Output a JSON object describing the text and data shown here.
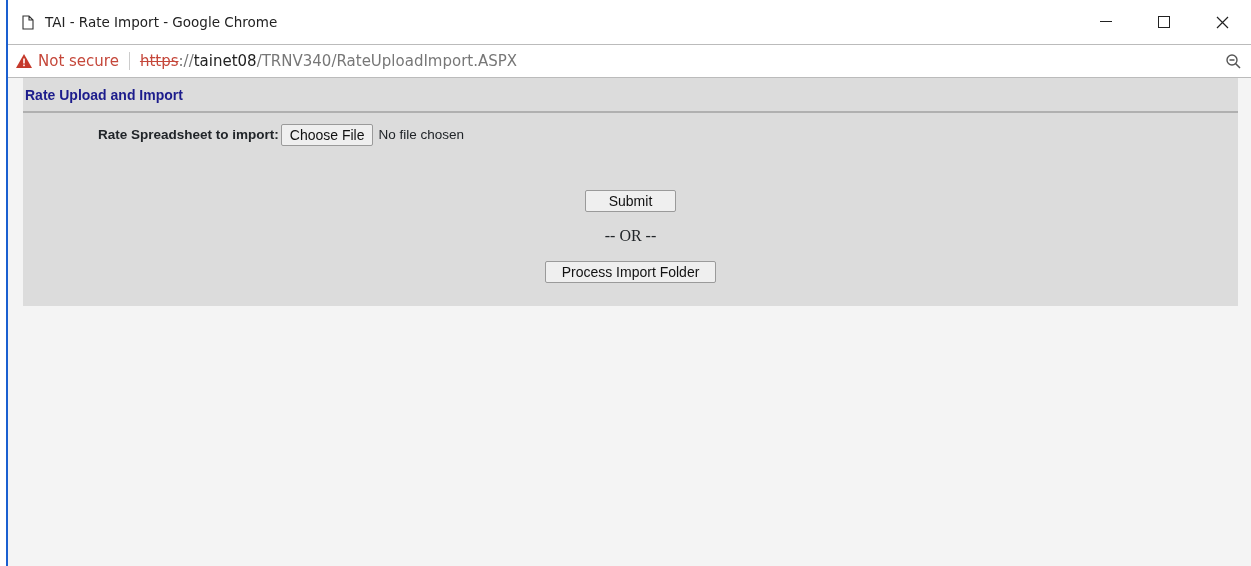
{
  "window": {
    "title": "TAI - Rate Import - Google Chrome"
  },
  "address_bar": {
    "security": "Not secure",
    "scheme": "https",
    "separator": "://",
    "host": "tainet08",
    "path": "/TRNV340/RateUploadImport.ASPX"
  },
  "page": {
    "heading": "Rate Upload and Import",
    "file_label": "Rate Spreadsheet to import:",
    "file_button": "Choose File",
    "file_status": "No file chosen",
    "submit": "Submit",
    "or_text": "-- OR --",
    "process": "Process Import Folder"
  }
}
